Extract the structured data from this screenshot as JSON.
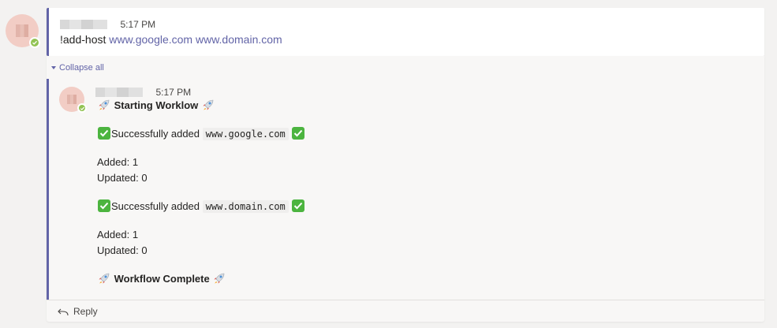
{
  "colors": {
    "accent": "#6264a7",
    "presence_available": "#92c353",
    "avatar_bg": "#f2cdc5"
  },
  "message": {
    "author_redacted": true,
    "time": "5:17 PM",
    "command": "!add-host",
    "links": [
      "www.google.com",
      "www.domain.com"
    ]
  },
  "thread": {
    "collapse_label": "Collapse all",
    "reply": {
      "author_redacted": true,
      "time": "5:17 PM",
      "start_text": "Starting Worklow",
      "results": [
        {
          "success_prefix": "Successfully added",
          "host": "www.google.com",
          "added_label": "Added: 1",
          "updated_label": "Updated: 0"
        },
        {
          "success_prefix": "Successfully added",
          "host": "www.domain.com",
          "added_label": "Added: 1",
          "updated_label": "Updated: 0"
        }
      ],
      "end_text": "Workflow Complete"
    },
    "reply_button_label": "Reply"
  },
  "icons": {
    "start_emoji": "rocket-icon",
    "success_emoji": "check-mark-button-icon",
    "reply": "reply-arrow-icon",
    "collapse": "triangle-down-icon",
    "presence": "presence-available-icon"
  }
}
